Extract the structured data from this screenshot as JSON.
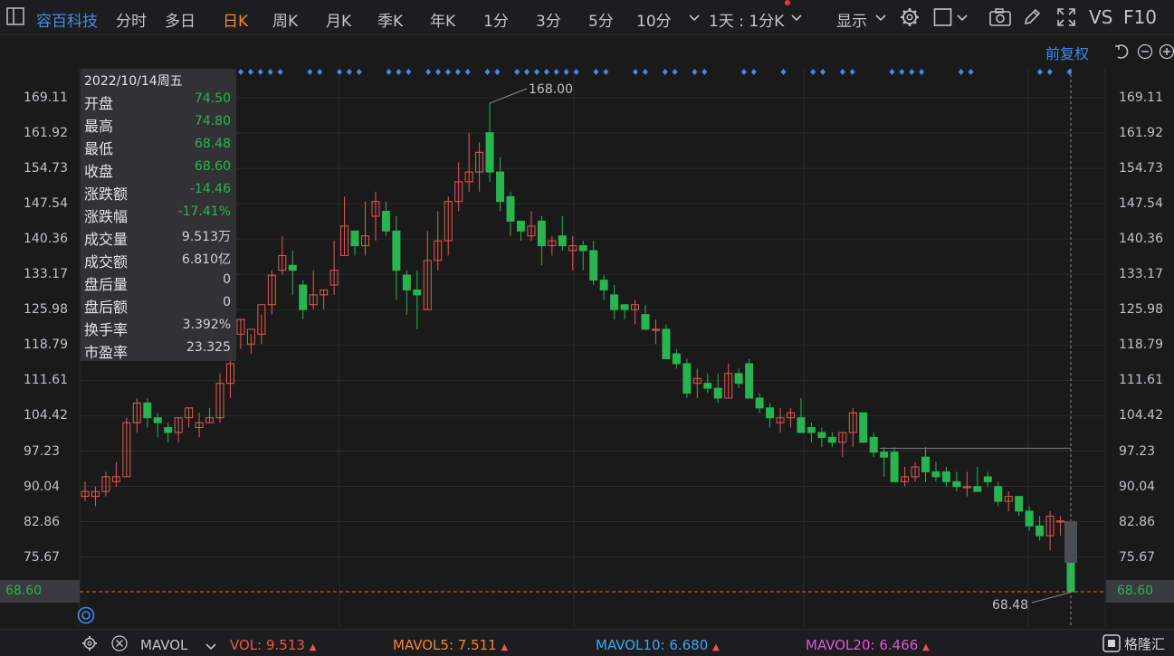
{
  "topbar": {
    "stock_name": "容百科技",
    "tabs": [
      "分时",
      "多日",
      "日K",
      "周K",
      "月K",
      "季K",
      "年K",
      "1分",
      "3分",
      "5分",
      "10分"
    ],
    "active_tab": "日K",
    "period_select": "1天 : 1分K",
    "display_label": "显示",
    "vs_label": "VS",
    "f10_label": "F10"
  },
  "adjust_label": "前复权",
  "info_panel": {
    "date": "2022/10/14周五",
    "rows": [
      {
        "label": "开盘",
        "value": "74.50",
        "color": "down"
      },
      {
        "label": "最高",
        "value": "74.80",
        "color": "down"
      },
      {
        "label": "最低",
        "value": "68.48",
        "color": "down"
      },
      {
        "label": "收盘",
        "value": "68.60",
        "color": "down"
      },
      {
        "label": "涨跌额",
        "value": "-14.46",
        "color": "down"
      },
      {
        "label": "涨跌幅",
        "value": "-17.41%",
        "color": "down"
      },
      {
        "label": "成交量",
        "value": "9.513万",
        "color": "plain"
      },
      {
        "label": "成交额",
        "value": "6.810亿",
        "color": "plain"
      },
      {
        "label": "盘后量",
        "value": "0",
        "color": "plain"
      },
      {
        "label": "盘后额",
        "value": "0",
        "color": "plain"
      },
      {
        "label": "换手率",
        "value": "3.392%",
        "color": "plain"
      },
      {
        "label": "市盈率",
        "value": "23.325",
        "color": "plain"
      }
    ]
  },
  "price_axis": [
    "169.11",
    "161.92",
    "154.73",
    "147.54",
    "140.36",
    "133.17",
    "125.98",
    "118.79",
    "111.61",
    "104.42",
    "97.23",
    "90.04",
    "82.86",
    "75.67"
  ],
  "current_price": "68.60",
  "high_annotation": "168.00",
  "low_annotation": "68.48",
  "colors": {
    "up": "#e8584f",
    "down": "#28b44f",
    "accent": "#3d8bf0",
    "active": "#f5852c"
  },
  "bottombar": {
    "indicator": "MAVOL",
    "vol_label": "VOL: ",
    "vol_value": "9.513",
    "mavol5_label": "MAVOL5: ",
    "mavol5_value": "7.511",
    "mavol10_label": "MAVOL10: ",
    "mavol10_value": "6.680",
    "mavol20_label": "MAVOL20: ",
    "mavol20_value": "6.466",
    "watermark": "格隆汇"
  },
  "chart_data": {
    "type": "candlestick",
    "ylim": [
      64,
      176
    ],
    "candles": [
      [
        88,
        91,
        87,
        89
      ],
      [
        88,
        90,
        86,
        89
      ],
      [
        89,
        93,
        88,
        92
      ],
      [
        91,
        95,
        90,
        92
      ],
      [
        92,
        104,
        92,
        103
      ],
      [
        103,
        108,
        101,
        107
      ],
      [
        107,
        108,
        102,
        104
      ],
      [
        104,
        105,
        100,
        103
      ],
      [
        102,
        103,
        99,
        101
      ],
      [
        101,
        104,
        99,
        104
      ],
      [
        104,
        106,
        102,
        106
      ],
      [
        102,
        105,
        100,
        103
      ],
      [
        103,
        106,
        103,
        104
      ],
      [
        104,
        113,
        103,
        111
      ],
      [
        111,
        117,
        108,
        115
      ],
      [
        121,
        124,
        118,
        124
      ],
      [
        119,
        121,
        117,
        122
      ],
      [
        121,
        125,
        119,
        127
      ],
      [
        127,
        134,
        125,
        133
      ],
      [
        134,
        141,
        133,
        137
      ],
      [
        135,
        138,
        129,
        134
      ],
      [
        131,
        132,
        124,
        126
      ],
      [
        127,
        134,
        126,
        129
      ],
      [
        129,
        130,
        126,
        130
      ],
      [
        131,
        140,
        129,
        134
      ],
      [
        137,
        149,
        137,
        143
      ],
      [
        142,
        141,
        137,
        139
      ],
      [
        139,
        148,
        137,
        141
      ],
      [
        145,
        150,
        140,
        148
      ],
      [
        146,
        148,
        141,
        142
      ],
      [
        142,
        145,
        128,
        134
      ],
      [
        133,
        134,
        125,
        130
      ],
      [
        130,
        134,
        122,
        129
      ],
      [
        126,
        142,
        126,
        136
      ],
      [
        136,
        146,
        134,
        140
      ],
      [
        140,
        149,
        137,
        148
      ],
      [
        148,
        156,
        146,
        152
      ],
      [
        152,
        162,
        150,
        154
      ],
      [
        154,
        160,
        150,
        158
      ],
      [
        162,
        168,
        152,
        154
      ],
      [
        154,
        157,
        146,
        148
      ],
      [
        149,
        150,
        141,
        144
      ],
      [
        144,
        144,
        140,
        142
      ],
      [
        141,
        146,
        140,
        143
      ],
      [
        144,
        145,
        135,
        139
      ],
      [
        139,
        141,
        137,
        140
      ],
      [
        141,
        145,
        138,
        139
      ],
      [
        138,
        141,
        134,
        139
      ],
      [
        139,
        140,
        134,
        138
      ],
      [
        138,
        140,
        131,
        132
      ],
      [
        132,
        133,
        128,
        130
      ],
      [
        129,
        131,
        124,
        126
      ],
      [
        127,
        127,
        124,
        126
      ],
      [
        126,
        128,
        123,
        127
      ],
      [
        125,
        127,
        122,
        122
      ],
      [
        122,
        124,
        119,
        122
      ],
      [
        122,
        123,
        116,
        116
      ],
      [
        117,
        118,
        114,
        115
      ],
      [
        115,
        116,
        108,
        109
      ],
      [
        111,
        114,
        108,
        112
      ],
      [
        111,
        113,
        109,
        110
      ],
      [
        110,
        113,
        107,
        108
      ],
      [
        108,
        115,
        108,
        113
      ],
      [
        113,
        114,
        110,
        111
      ],
      [
        115,
        116,
        108,
        108
      ],
      [
        108,
        109,
        105,
        106
      ],
      [
        106,
        107,
        102,
        104
      ],
      [
        103,
        106,
        101,
        104
      ],
      [
        104,
        106,
        102,
        105
      ],
      [
        104,
        108,
        101,
        101
      ],
      [
        102,
        103,
        99,
        101
      ],
      [
        101,
        102,
        98,
        100
      ],
      [
        100,
        101,
        98,
        99
      ],
      [
        99,
        101,
        96,
        101
      ],
      [
        101,
        106,
        98,
        105
      ],
      [
        105,
        105,
        99,
        99
      ],
      [
        100,
        101,
        96,
        97
      ],
      [
        97,
        98,
        92,
        96
      ],
      [
        97,
        98,
        91,
        91
      ],
      [
        91,
        94,
        90,
        92
      ],
      [
        92,
        95,
        91,
        94
      ],
      [
        96,
        98,
        91,
        93
      ],
      [
        93,
        95,
        91,
        92
      ],
      [
        93,
        94,
        90,
        91
      ],
      [
        91,
        93,
        89,
        90
      ],
      [
        90,
        93,
        88,
        90
      ],
      [
        90,
        94,
        89,
        89
      ],
      [
        92,
        93,
        90,
        91
      ],
      [
        90,
        91,
        86,
        87
      ],
      [
        87,
        89,
        85,
        88
      ],
      [
        88,
        88,
        84,
        85
      ],
      [
        85,
        86,
        81,
        82
      ],
      [
        82,
        84,
        79,
        80
      ],
      [
        80,
        85,
        77,
        84
      ],
      [
        83,
        84,
        80,
        83
      ],
      [
        74.5,
        74.8,
        68.48,
        68.6
      ]
    ]
  }
}
